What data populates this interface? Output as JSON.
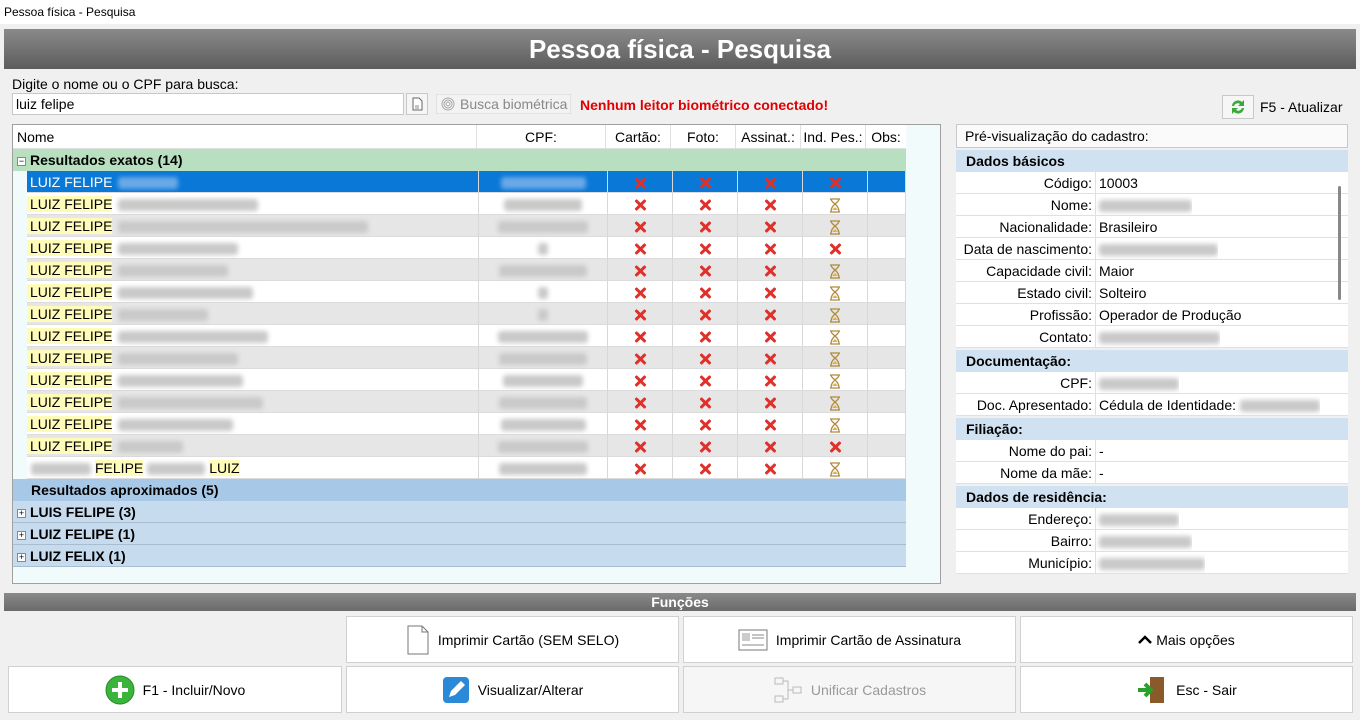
{
  "window_title": "Pessoa física - Pesquisa",
  "header_title": "Pessoa física - Pesquisa",
  "search": {
    "label": "Digite o nome ou o CPF para busca:",
    "value": "luiz felipe",
    "biometric_label": "Busca biométrica",
    "biometric_warning": "Nenhum leitor biométrico conectado!"
  },
  "refresh_label": "F5 - Atualizar",
  "grid": {
    "columns": [
      "Nome",
      "CPF:",
      "Cartão:",
      "Foto:",
      "Assinat.:",
      "Ind. Pes.:",
      "Obs:"
    ],
    "exact_group": "Resultados exatos (14)",
    "rows": [
      {
        "name": "LUIZ FELIPE",
        "ind": "x"
      },
      {
        "name": "LUIZ FELIPE",
        "ind": "hourglass"
      },
      {
        "name": "LUIZ FELIPE",
        "ind": "hourglass"
      },
      {
        "name": "LUIZ FELIPE",
        "ind": "x"
      },
      {
        "name": "LUIZ FELIPE",
        "ind": "hourglass"
      },
      {
        "name": "LUIZ FELIPE",
        "ind": "hourglass"
      },
      {
        "name": "LUIZ FELIPE",
        "ind": "hourglass"
      },
      {
        "name": "LUIZ FELIPE",
        "ind": "hourglass"
      },
      {
        "name": "LUIZ FELIPE",
        "ind": "hourglass"
      },
      {
        "name": "LUIZ FELIPE",
        "ind": "hourglass"
      },
      {
        "name": "LUIZ FELIPE",
        "ind": "hourglass"
      },
      {
        "name": "LUIZ FELIPE",
        "ind": "hourglass"
      },
      {
        "name": "LUIZ FELIPE",
        "ind": "x"
      },
      {
        "name": "FELIPE",
        "name2": "LUIZ",
        "ind": "hourglass"
      }
    ],
    "approx_group": "Resultados aproximados (5)",
    "approx_subgroups": [
      "LUIS FELIPE (3)",
      "LUIZ FELIPE (1)",
      "LUIZ FELIX (1)"
    ]
  },
  "preview": {
    "title": "Pré-visualização do cadastro:",
    "sections": {
      "basic": "Dados básicos",
      "docs": "Documentação:",
      "filiation": "Filiação:",
      "residence": "Dados de residência:"
    },
    "basic": [
      {
        "label": "Código:",
        "value": "10003"
      },
      {
        "label": "Nome:",
        "value": ""
      },
      {
        "label": "Nacionalidade:",
        "value": "Brasileiro"
      },
      {
        "label": "Data de nascimento:",
        "value": ""
      },
      {
        "label": "Capacidade civil:",
        "value": "Maior"
      },
      {
        "label": "Estado civil:",
        "value": "Solteiro"
      },
      {
        "label": "Profissão:",
        "value": "Operador de Produção"
      },
      {
        "label": "Contato:",
        "value": ""
      }
    ],
    "docs": [
      {
        "label": "CPF:",
        "value": ""
      },
      {
        "label": "Doc. Apresentado:",
        "value": "Cédula de Identidade:"
      }
    ],
    "filiation": [
      {
        "label": "Nome do pai:",
        "value": "-"
      },
      {
        "label": "Nome da mãe:",
        "value": "-"
      }
    ],
    "residence": [
      {
        "label": "Endereço:",
        "value": ""
      },
      {
        "label": "Bairro:",
        "value": ""
      },
      {
        "label": "Município:",
        "value": ""
      }
    ]
  },
  "functions": {
    "title": "Funções",
    "print_card": "Imprimir Cartão (SEM SELO)",
    "print_signature": "Imprimir Cartão de Assinatura",
    "more": "Mais opções",
    "new": "F1 - Incluir/Novo",
    "edit": "Visualizar/Alterar",
    "merge": "Unificar Cadastros",
    "exit": "Esc - Sair"
  },
  "colors": {
    "selected_row": "#0a78d7",
    "exact_group": "#b8e0c0",
    "warning": "#e00000"
  }
}
